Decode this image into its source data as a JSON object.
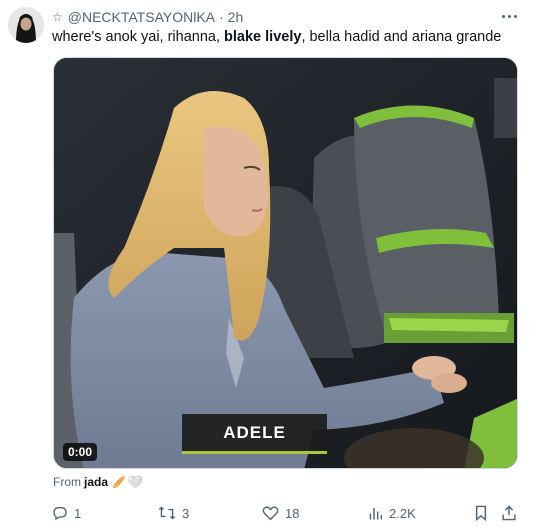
{
  "tweet": {
    "author_handle": "@NECKTATSAYONlKA",
    "timestamp": "2h",
    "separator": "·",
    "text_part1": "where's anok yai, rihanna, ",
    "text_bold": "blake lively",
    "text_part2": ", bella hadid and ariana grande"
  },
  "media": {
    "duration": "0:00",
    "on_screen_caption": "ADELE"
  },
  "attribution": {
    "prefix": "From",
    "source": "jada",
    "emoji1": "🥖",
    "emoji2": "🤍"
  },
  "actions": {
    "replies": "1",
    "reposts": "3",
    "likes": "18",
    "views": "2.2K"
  },
  "icons": {
    "badge": "star-icon",
    "more": "more-options-icon",
    "reply": "reply-icon",
    "repost": "repost-icon",
    "like": "heart-icon",
    "views": "views-icon",
    "bookmark": "bookmark-icon",
    "share": "share-icon"
  },
  "colors": {
    "secondary_text": "#536471",
    "primary_text": "#0f1419",
    "caption_accent": "#a8c83a"
  }
}
